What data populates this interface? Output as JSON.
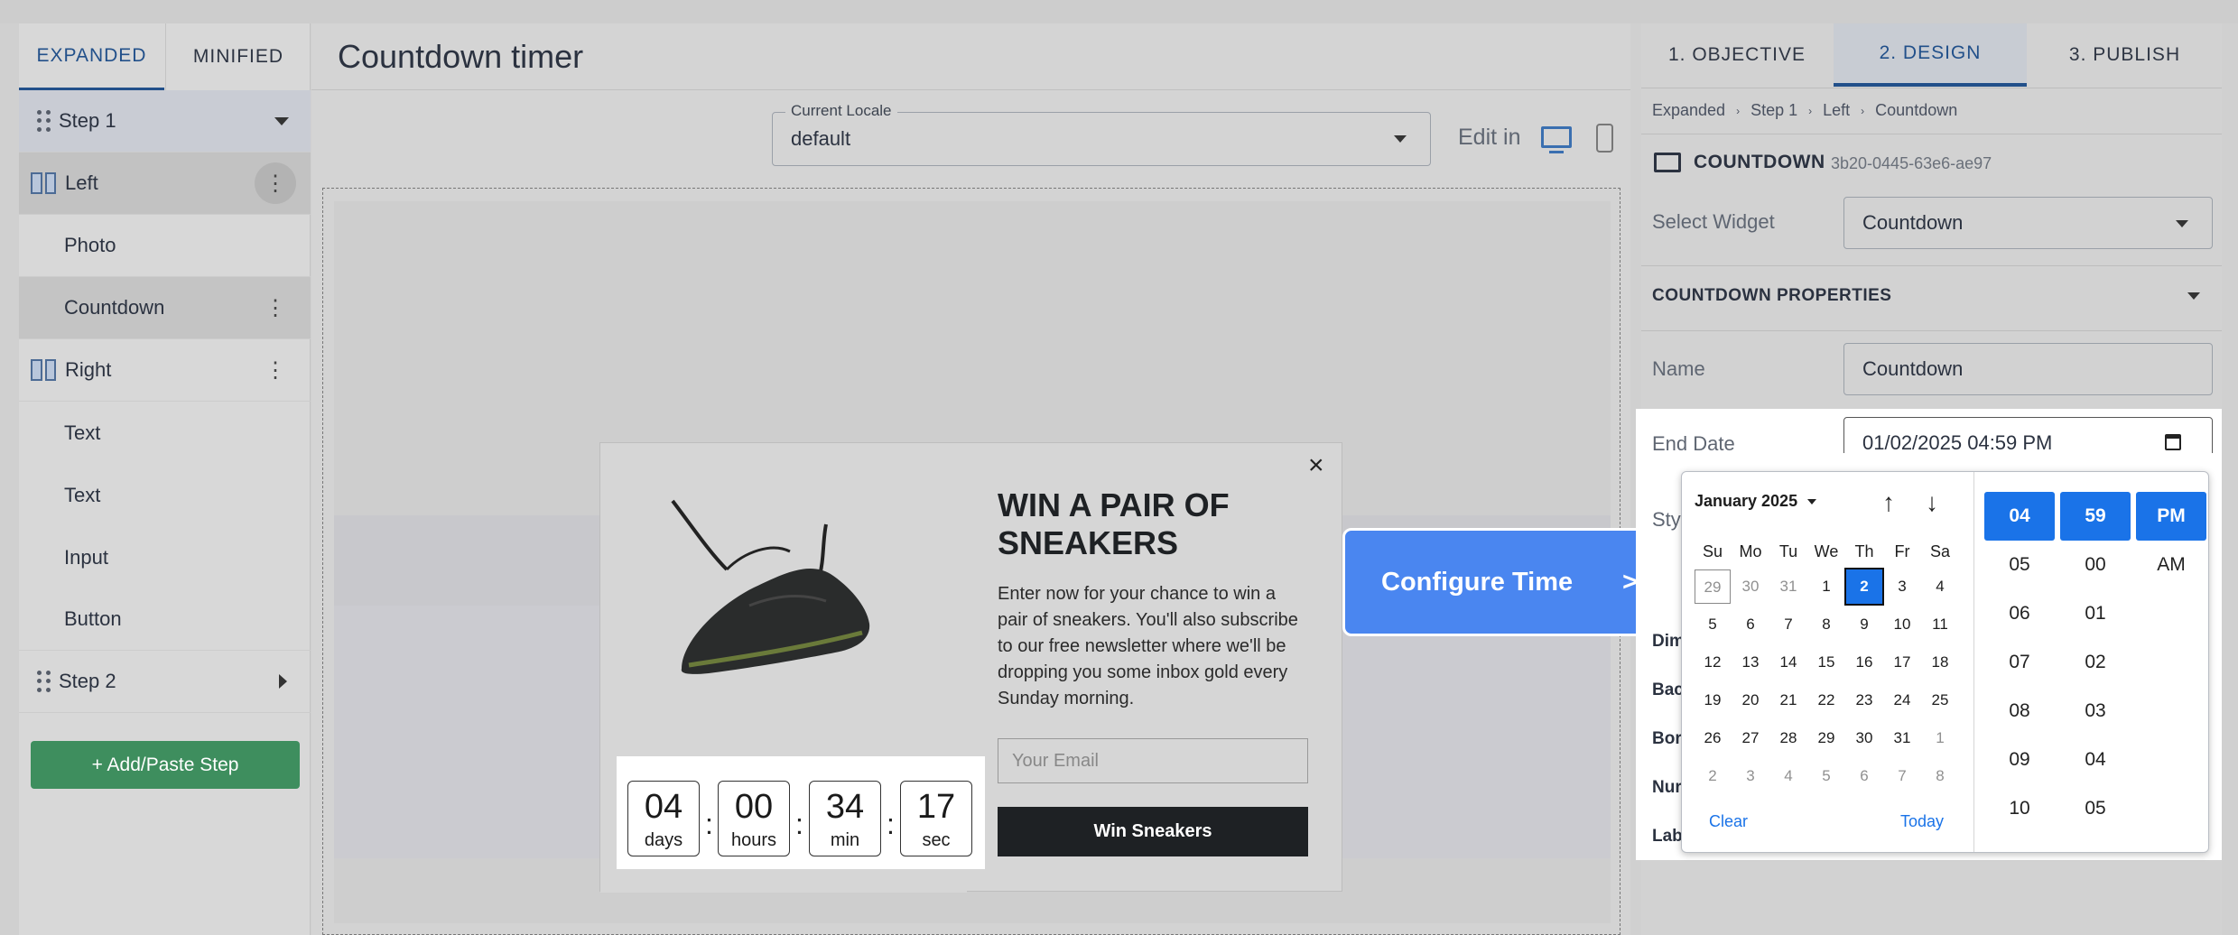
{
  "left_panel": {
    "tabs": [
      "EXPANDED",
      "MINIFIED"
    ],
    "items": [
      {
        "label": "Step 1"
      },
      {
        "label": "Left"
      },
      {
        "label": "Photo"
      },
      {
        "label": "Countdown"
      },
      {
        "label": "Right"
      },
      {
        "label": "Text"
      },
      {
        "label": "Text"
      },
      {
        "label": "Input"
      },
      {
        "label": "Button"
      },
      {
        "label": "Step 2"
      }
    ],
    "add_step": "+ Add/Paste Step"
  },
  "center": {
    "title": "Countdown timer",
    "locale_label": "Current Locale",
    "locale_value": "default",
    "edit_in": "Edit in"
  },
  "popup": {
    "heading": "WIN A PAIR OF SNEAKERS",
    "body": "Enter now for your chance to win a pair of sneakers. You'll also subscribe to our free newsletter where we'll be dropping you some inbox gold every Sunday morning.",
    "email_placeholder": "Your Email",
    "button": "Win Sneakers",
    "close": "×",
    "countdown": [
      {
        "value": "04",
        "unit": "days"
      },
      {
        "value": "00",
        "unit": "hours"
      },
      {
        "value": "34",
        "unit": "min"
      },
      {
        "value": "17",
        "unit": "sec"
      }
    ]
  },
  "callout": {
    "label": "Configure Time",
    "arrow": ">"
  },
  "right_panel": {
    "tabs": [
      "1. OBJECTIVE",
      "2. DESIGN",
      "3. PUBLISH"
    ],
    "breadcrumb": [
      "Expanded",
      "Step 1",
      "Left",
      "Countdown"
    ],
    "widget_title": "COUNTDOWN",
    "widget_id": "3b20-0445-63e6-ae97",
    "select_widget_label": "Select Widget",
    "select_widget_value": "Countdown",
    "section_title": "COUNTDOWN PROPERTIES",
    "name_label": "Name",
    "name_value": "Countdown",
    "end_date_label": "End Date",
    "end_date_value": "01/02/2025  04:59  PM",
    "cut_labels": [
      "Sty",
      "Dim",
      "Bac",
      "Bor",
      "Nur",
      "Lab"
    ]
  },
  "datepicker": {
    "month_label": "January 2025",
    "weekdays": [
      "Su",
      "Mo",
      "Tu",
      "We",
      "Th",
      "Fr",
      "Sa"
    ],
    "weeks": [
      [
        "29",
        "30",
        "31",
        "1",
        "2",
        "3",
        "4"
      ],
      [
        "5",
        "6",
        "7",
        "8",
        "9",
        "10",
        "11"
      ],
      [
        "12",
        "13",
        "14",
        "15",
        "16",
        "17",
        "18"
      ],
      [
        "19",
        "20",
        "21",
        "22",
        "23",
        "24",
        "25"
      ],
      [
        "26",
        "27",
        "28",
        "29",
        "30",
        "31",
        "1"
      ],
      [
        "2",
        "3",
        "4",
        "5",
        "6",
        "7",
        "8"
      ]
    ],
    "selected_day": "2",
    "clear": "Clear",
    "today": "Today",
    "hours": [
      "04",
      "05",
      "06",
      "07",
      "08",
      "09",
      "10"
    ],
    "minutes": [
      "59",
      "00",
      "01",
      "02",
      "03",
      "04",
      "05"
    ],
    "ampm": [
      "PM",
      "AM"
    ]
  },
  "colors": {
    "accent": "#1a73e8",
    "add_step_green": "#3e8e5e",
    "callout_blue": "#4a86f0",
    "dark_button": "#1e2124"
  }
}
